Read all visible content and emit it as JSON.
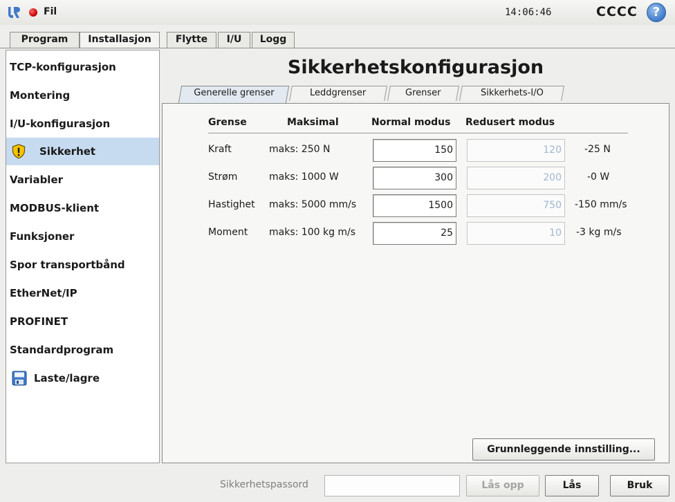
{
  "header": {
    "file_label": "Fil",
    "time": "14:06:46",
    "robot_name": "CCCC",
    "help_symbol": "?",
    "icons": {
      "logo": "ur-logo-icon",
      "status": "red-status-dot-icon",
      "help": "help-icon"
    }
  },
  "main_tabs": [
    {
      "label": "Program",
      "active": false
    },
    {
      "label": "Installasjon",
      "active": true
    },
    {
      "label": "Flytte",
      "active": false
    },
    {
      "label": "I/U",
      "active": false
    },
    {
      "label": "Logg",
      "active": false
    }
  ],
  "sidebar": {
    "items": [
      {
        "label": "TCP-konfigurasjon"
      },
      {
        "label": "Montering"
      },
      {
        "label": "I/U-konfigurasjon"
      },
      {
        "label": "Sikkerhet",
        "selected": true,
        "icon": "warning-shield-icon"
      },
      {
        "label": "Variabler"
      },
      {
        "label": "MODBUS-klient"
      },
      {
        "label": "Funksjoner"
      },
      {
        "label": "Spor transportbånd"
      },
      {
        "label": "EtherNet/IP"
      },
      {
        "label": "PROFINET"
      },
      {
        "label": "Standardprogram"
      },
      {
        "label": "Laste/lagre",
        "icon": "floppy-disk-icon"
      }
    ]
  },
  "main": {
    "title": "Sikkerhetskonfigurasjon",
    "sub_tabs": [
      {
        "label": "Generelle grenser",
        "active": true
      },
      {
        "label": "Leddgrenser",
        "active": false
      },
      {
        "label": "Grenser",
        "active": false
      },
      {
        "label": "Sikkerhets-I/O",
        "active": false
      }
    ],
    "table": {
      "headers": {
        "limit": "Grense",
        "max": "Maksimal",
        "normal": "Normal modus",
        "reduced": "Redusert modus"
      },
      "rows": [
        {
          "name": "Kraft",
          "max": "maks: 250 N",
          "normal": "150",
          "reduced": "120",
          "delta": "-25 N"
        },
        {
          "name": "Strøm",
          "max": "maks: 1000 W",
          "normal": "300",
          "reduced": "200",
          "delta": "-0 W"
        },
        {
          "name": "Hastighet",
          "max": "maks: 5000 mm/s",
          "normal": "1500",
          "reduced": "750",
          "delta": "-150 mm/s"
        },
        {
          "name": "Moment",
          "max": "maks: 100 kg m/s",
          "normal": "25",
          "reduced": "10",
          "delta": "-3 kg m/s"
        }
      ]
    },
    "advanced_button": "Grunnleggende innstilling..."
  },
  "footer": {
    "password_label": "Sikkerhetspassord",
    "password_value": "",
    "unlock_label": "Lås opp",
    "lock_label": "Lås",
    "apply_label": "Bruk"
  },
  "colors": {
    "selected_bg": "#c7dbf0",
    "reduced_text": "#9fb6d0",
    "status_red": "#c40000",
    "help_blue": "#3f79c8",
    "warning_yellow": "#f5c400"
  }
}
